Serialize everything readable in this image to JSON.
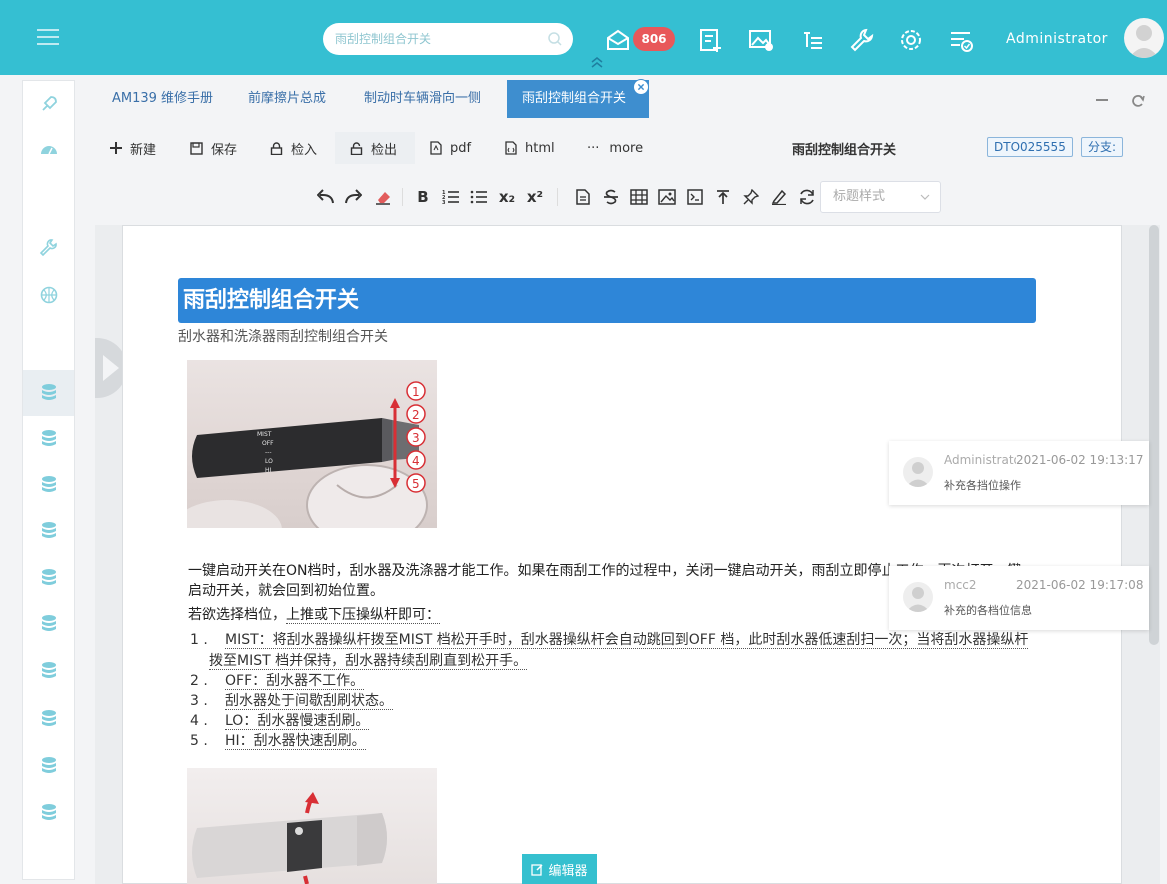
{
  "header": {
    "search_placeholder": "雨刮控制组合开关",
    "mail_count": "806",
    "username": "Administrator"
  },
  "tabs": [
    {
      "label": "AM139 维修手册"
    },
    {
      "label": "前摩擦片总成"
    },
    {
      "label": "制动时车辆滑向一侧"
    },
    {
      "label": "雨刮控制组合开关"
    }
  ],
  "toolbar": {
    "new": "新建",
    "save": "保存",
    "checkin": "检入",
    "checkout": "检出",
    "pdf": "pdf",
    "html": "html",
    "more": "more",
    "doc_title": "雨刮控制组合开关",
    "dto": "DTO025555",
    "branch": "分支:"
  },
  "editor": {
    "heading_select": "标题样式",
    "bold": "B",
    "sub": "x₂",
    "sup": "x²"
  },
  "document": {
    "heading": "雨刮控制组合开关",
    "subtitle": "刮水器和洗涤器雨刮控制组合开关",
    "para1_line1": "一键启动开关在ON档时，刮水器及洗涤器才能工作。如果在雨刮工作的过程中，关闭一键启动开关，雨刮立即停止工作，再次打开一键",
    "para1_line2": "启动开关，就会回到初始位置。",
    "para2_prefix": "若欲选择档位，",
    "para2_underlined": "上推或下压操纵杆即可：",
    "list": [
      {
        "num": "1 .",
        "line1": "MIST：将刮水器操纵杆拨至MIST 档松开手时，刮水器操纵杆会自动跳回到OFF 档，此时刮水器低速刮扫一次；当将刮水器操纵杆",
        "line2": "拨至MIST 档并保持，刮水器持续刮刷直到松开手。"
      },
      {
        "num": "2 .",
        "line1": "OFF：刮水器不工作。"
      },
      {
        "num": "3 .",
        "line1": "刮水器处于间歇刮刷状态。"
      },
      {
        "num": "4 .",
        "line1": "LO：刮水器慢速刮刷。"
      },
      {
        "num": "5 .",
        "line1": "HI：刮水器快速刮刷。"
      }
    ],
    "stalk_labels": [
      "MIST",
      "OFF",
      "---",
      "LO",
      "HI"
    ],
    "step_numbers": [
      "1",
      "2",
      "3",
      "4",
      "5"
    ]
  },
  "comments": [
    {
      "user": "Administrator",
      "time": "2021-06-02 19:13:17",
      "text": "补充各挡位操作"
    },
    {
      "user": "mcc2",
      "time": "2021-06-02 19:17:08",
      "text": "补充的各档位信息"
    }
  ],
  "editor_button": "编辑器"
}
